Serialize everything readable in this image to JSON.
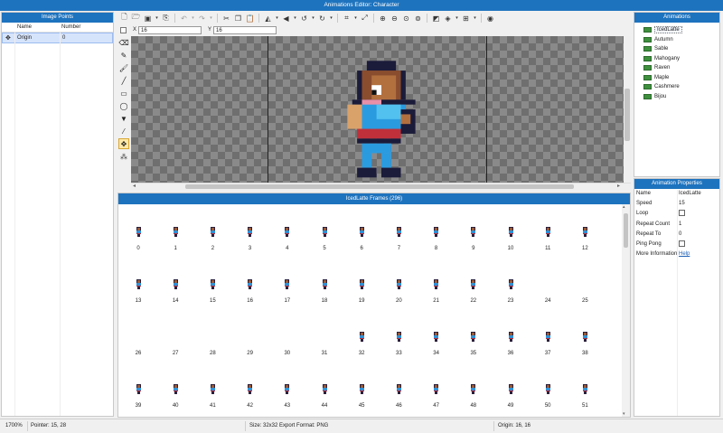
{
  "window": {
    "title": "Animations Editor: Character"
  },
  "image_points": {
    "header": "Image Points",
    "columns": [
      "Name",
      "Number"
    ],
    "rows": [
      {
        "name": "Origin",
        "number": "0"
      }
    ]
  },
  "toolbar": {
    "icons": [
      "new-file-icon",
      "open-folder-icon",
      "save-icon",
      "dropdown-icon",
      "export-icon",
      "undo-icon",
      "dropdown-icon",
      "redo-icon",
      "dropdown-icon",
      "cut-icon",
      "copy-icon",
      "paste-icon",
      "flip-horizontal-icon",
      "dropdown-icon",
      "flip-vertical-icon",
      "dropdown-icon",
      "rotate-left-icon",
      "dropdown-icon",
      "rotate-right-icon",
      "dropdown-icon",
      "crop-icon",
      "dropdown-icon",
      "resize-icon",
      "zoom-in-icon",
      "zoom-out-icon",
      "zoom-fit-icon",
      "zoom-actual-icon",
      "color-mode-icon",
      "layers-icon",
      "dropdown-icon",
      "grid-icon",
      "dropdown-icon",
      "target-icon"
    ]
  },
  "coords": {
    "x_label": "X",
    "x_value": "16",
    "y_label": "Y",
    "y_value": "16"
  },
  "tools": [
    "eraser-icon",
    "pencil-icon",
    "brush-icon",
    "line-icon",
    "rectangle-icon",
    "ellipse-icon",
    "fill-bucket-icon",
    "eyedropper-icon",
    "image-point-icon",
    "node-icon"
  ],
  "frames": {
    "header": "IcedLatte Frames (296)",
    "numbers": [
      "0",
      "1",
      "2",
      "3",
      "4",
      "5",
      "6",
      "7",
      "8",
      "9",
      "10",
      "11",
      "12",
      "13",
      "14",
      "15",
      "16",
      "17",
      "18",
      "19",
      "20",
      "21",
      "22",
      "23",
      "24",
      "25",
      "26",
      "27",
      "28",
      "29",
      "30",
      "31",
      "32",
      "33",
      "34",
      "35",
      "36",
      "37",
      "38",
      "39",
      "40",
      "41",
      "42",
      "43",
      "44",
      "45",
      "46",
      "47",
      "48",
      "49",
      "50",
      "51"
    ],
    "filled": [
      0,
      1,
      2,
      3,
      4,
      5,
      6,
      7,
      8,
      9,
      10,
      11,
      12,
      13,
      14,
      15,
      16,
      17,
      18,
      19,
      20,
      21,
      22,
      23,
      32,
      33,
      34,
      35,
      36,
      37,
      38,
      39,
      40,
      41,
      42,
      43,
      44,
      45,
      46,
      47,
      48,
      49,
      50,
      51
    ]
  },
  "animations": {
    "header": "Animations",
    "items": [
      "IcedLatte",
      "Autumn",
      "Sable",
      "Mahogany",
      "Raven",
      "Maple",
      "Cashmere",
      "Bijou"
    ],
    "selected": "IcedLatte"
  },
  "properties": {
    "header": "Animation Properties",
    "name_label": "Name",
    "name_value": "IcedLatte",
    "speed_label": "Speed",
    "speed_value": "15",
    "loop_label": "Loop",
    "repeat_count_label": "Repeat Count",
    "repeat_count_value": "1",
    "repeat_to_label": "Repeat To",
    "repeat_to_value": "0",
    "ping_pong_label": "Ping Pong",
    "more_info_label": "More Information",
    "help_link": "Help"
  },
  "status": {
    "zoom": "1700%",
    "pointer": "Pointer: 15, 28",
    "size": "Size: 32x32",
    "export_format": "Export Format: PNG",
    "origin": "Origin: 16, 16"
  },
  "colors": {
    "accent": "#1e73be",
    "selected_row": "#d6e4fb",
    "checker_dark": "#6f6f6f",
    "checker_light": "#8a8a8a"
  }
}
